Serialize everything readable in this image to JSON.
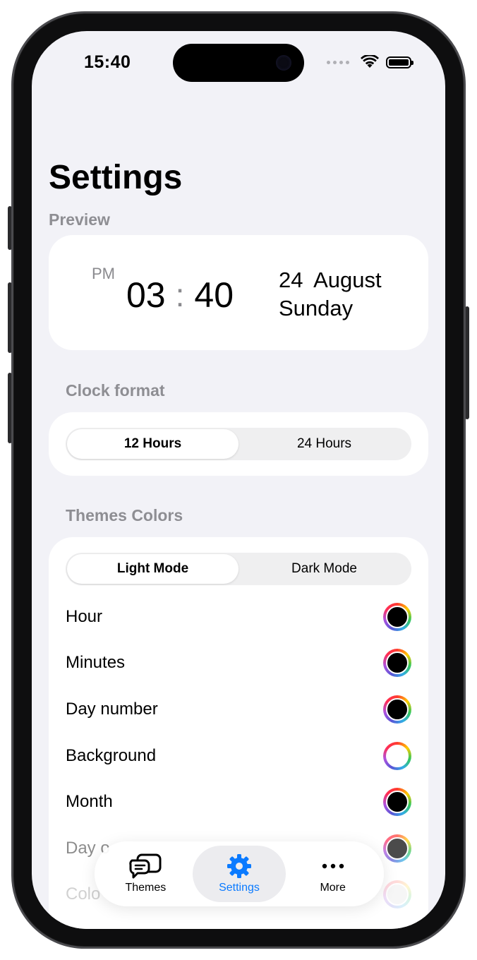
{
  "status": {
    "time": "15:40"
  },
  "page": {
    "title": "Settings"
  },
  "preview": {
    "label": "Preview",
    "ampm": "PM",
    "hour": "03",
    "separator": ":",
    "minute": "40",
    "date_day": "24",
    "date_month": "August",
    "weekday": "Sunday"
  },
  "clock_format": {
    "label": "Clock format",
    "options": [
      "12 Hours",
      "24 Hours"
    ],
    "selected": "12 Hours"
  },
  "themes": {
    "label": "Themes Colors",
    "modes": [
      "Light Mode",
      "Dark Mode"
    ],
    "selected_mode": "Light Mode",
    "rows": [
      {
        "label": "Hour",
        "color": "#000000"
      },
      {
        "label": "Minutes",
        "color": "#000000"
      },
      {
        "label": "Day number",
        "color": "#000000"
      },
      {
        "label": "Background",
        "color": "#ffffff"
      },
      {
        "label": "Month",
        "color": "#000000"
      },
      {
        "label": "Day o",
        "color": "#000000"
      },
      {
        "label": "Colo",
        "color": "#cccccc"
      }
    ]
  },
  "tabbar": {
    "tabs": [
      {
        "label": "Themes",
        "icon": "chat-bubbles-icon"
      },
      {
        "label": "Settings",
        "icon": "gear-icon"
      },
      {
        "label": "More",
        "icon": "ellipsis-icon"
      }
    ],
    "active": "Settings",
    "accent": "#0a7aff"
  }
}
